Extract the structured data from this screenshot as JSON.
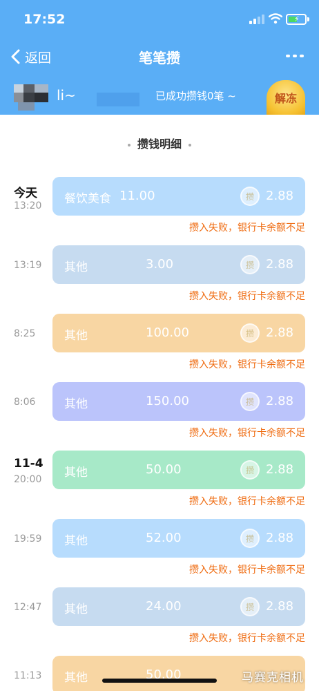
{
  "status_bar": {
    "time": "17:52"
  },
  "nav": {
    "back_label": "返回",
    "title": "笔笔攒"
  },
  "user": {
    "name": "li~",
    "saved_status": "已成功攒钱0笔 ~",
    "unfreeze_label": "解冻"
  },
  "section": {
    "title": "攒钱明细"
  },
  "records": [
    {
      "date": "今天",
      "time": "13:20",
      "category": "餐饮美食",
      "amount": "11.00",
      "save_amount": "2.88",
      "coin": "攒",
      "status": "攒入失败，银行卡余额不足",
      "color": "#b7dcfd"
    },
    {
      "date": "",
      "time": "13:19",
      "category": "其他",
      "amount": "3.00",
      "save_amount": "2.88",
      "coin": "攒",
      "status": "攒入失败，银行卡余额不足",
      "color": "#c6dbf0"
    },
    {
      "date": "",
      "time": "8:25",
      "category": "其他",
      "amount": "100.00",
      "save_amount": "2.88",
      "coin": "攒",
      "status": "攒入失败，银行卡余额不足",
      "color": "#f8d6a3"
    },
    {
      "date": "",
      "time": "8:06",
      "category": "其他",
      "amount": "150.00",
      "save_amount": "2.88",
      "coin": "攒",
      "status": "攒入失败，银行卡余额不足",
      "color": "#bbc4fb"
    },
    {
      "date": "11-4",
      "time": "20:00",
      "category": "其他",
      "amount": "50.00",
      "save_amount": "2.88",
      "coin": "攒",
      "status": "攒入失败，银行卡余额不足",
      "color": "#a7e9c8"
    },
    {
      "date": "",
      "time": "19:59",
      "category": "其他",
      "amount": "52.00",
      "save_amount": "2.88",
      "coin": "攒",
      "status": "攒入失败，银行卡余额不足",
      "color": "#b7dcfd"
    },
    {
      "date": "",
      "time": "12:47",
      "category": "其他",
      "amount": "24.00",
      "save_amount": "2.88",
      "coin": "攒",
      "status": "攒入失败，银行卡余额不足",
      "color": "#c6dbf0"
    },
    {
      "date": "",
      "time": "11:13",
      "category": "其他",
      "amount": "50.00",
      "save_amount": "",
      "coin": "",
      "status": "",
      "color": "#f8d6a3"
    }
  ],
  "watermark": "马赛克相机",
  "colors": {
    "header": "#5aaef6",
    "error": "#ef6a0e"
  },
  "icons": [
    "signal-icon",
    "wifi-icon",
    "battery-icon",
    "back-chevron-icon",
    "more-icon",
    "coin-icon"
  ]
}
